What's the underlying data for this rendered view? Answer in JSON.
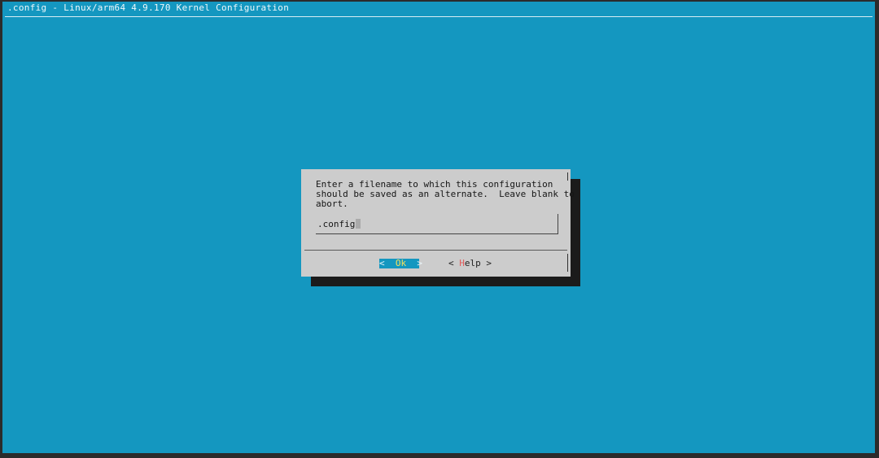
{
  "window": {
    "title": ".config - Linux/arm64 4.9.170 Kernel Configuration"
  },
  "dialog": {
    "prompt_lines": [
      "Enter a filename to which this configuration",
      "should be saved as an alternate.  Leave blank to",
      "abort."
    ],
    "input_value": ".config",
    "ok_button": {
      "left": "<",
      "hotkey": "O",
      "rest": "k",
      "right": ">"
    },
    "help_button": {
      "left": "<",
      "hotkey": "H",
      "rest": "elp",
      "right": ">"
    }
  },
  "colors": {
    "background": "#1497c0",
    "dialog": "#cccccc",
    "shadow": "#1b1b1b",
    "ok_hotkey": "#f7e25b",
    "help_hotkey": "#e05c5c"
  }
}
